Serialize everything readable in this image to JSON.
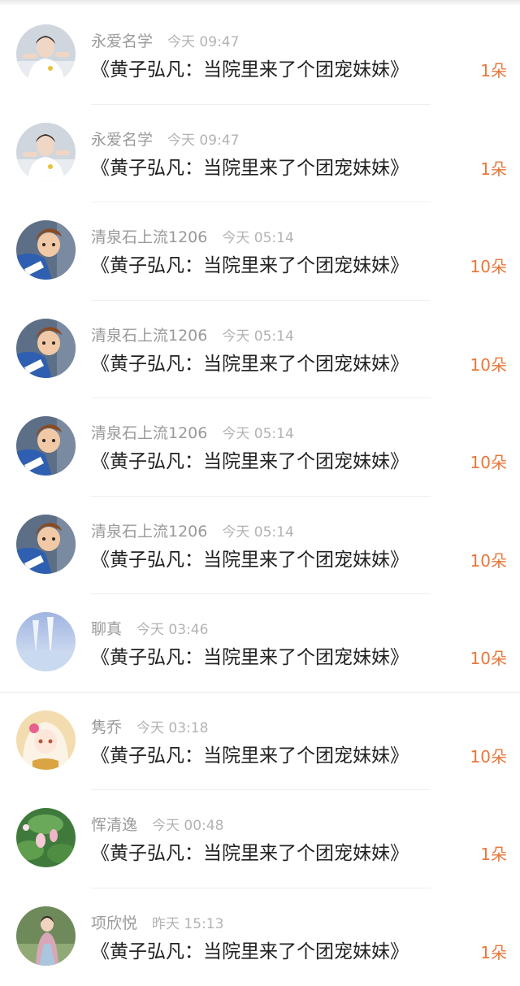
{
  "items": [
    {
      "name": "永爱名学",
      "time": "今天 09:47",
      "title": "《黄子弘凡：当院里来了个团宠妹妹》",
      "count": "1朵",
      "avatar": "person-avatar"
    },
    {
      "name": "永爱名学",
      "time": "今天 09:47",
      "title": "《黄子弘凡：当院里来了个团宠妹妹》",
      "count": "1朵",
      "avatar": "person-avatar"
    },
    {
      "name": "清泉石上流1206",
      "time": "今天 05:14",
      "title": "《黄子弘凡：当院里来了个团宠妹妹》",
      "count": "10朵",
      "avatar": "cartoon-prince-avatar"
    },
    {
      "name": "清泉石上流1206",
      "time": "今天 05:14",
      "title": "《黄子弘凡：当院里来了个团宠妹妹》",
      "count": "10朵",
      "avatar": "cartoon-prince-avatar"
    },
    {
      "name": "清泉石上流1206",
      "time": "今天 05:14",
      "title": "《黄子弘凡：当院里来了个团宠妹妹》",
      "count": "10朵",
      "avatar": "cartoon-prince-avatar"
    },
    {
      "name": "清泉石上流1206",
      "time": "今天 05:14",
      "title": "《黄子弘凡：当院里来了个团宠妹妹》",
      "count": "10朵",
      "avatar": "cartoon-prince-avatar"
    },
    {
      "name": "聊真",
      "time": "今天 03:46",
      "title": "《黄子弘凡：当院里来了个团宠妹妹》",
      "count": "10朵",
      "avatar": "blue-scenery-avatar"
    },
    {
      "name": "隽乔",
      "time": "今天 03:18",
      "title": "《黄子弘凡：当院里来了个团宠妹妹》",
      "count": "10朵",
      "avatar": "anime-girl-avatar"
    },
    {
      "name": "恽清逸",
      "time": "今天 00:48",
      "title": "《黄子弘凡：当院里来了个团宠妹妹》",
      "count": "1朵",
      "avatar": "lotus-avatar"
    },
    {
      "name": "项欣悦",
      "time": "昨天 15:13",
      "title": "《黄子弘凡：当院里来了个团宠妹妹》",
      "count": "1朵",
      "avatar": "girl-photo-avatar"
    }
  ],
  "colors": {
    "count": "#e8773a",
    "name": "#9a9a9a",
    "time": "#b3b3b3",
    "title": "#222222"
  }
}
